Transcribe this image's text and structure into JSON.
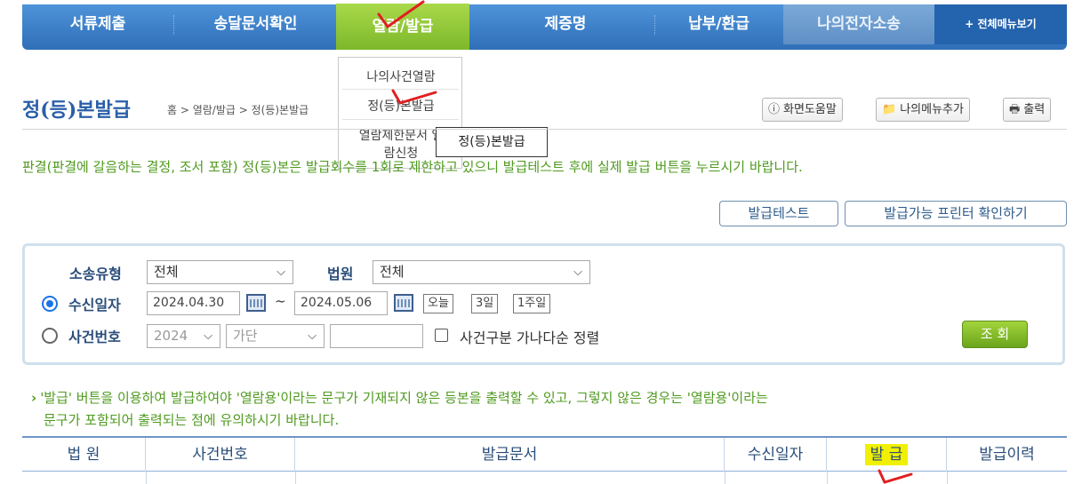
{
  "nav": {
    "items": [
      "서류제출",
      "송달문서확인",
      "열람/발급",
      "제증명",
      "납부/환급",
      "나의전자소송"
    ],
    "all_menu": "+ 전체메뉴보기"
  },
  "dropdown": {
    "items": [
      "나의사건열람",
      "정(등)본발급",
      "열람제한문서 열",
      "람신청"
    ],
    "tooltip": "정(등)본발급"
  },
  "page": {
    "title": "정(등)본발급",
    "breadcrumb": "홈 > 열람/발급 > 정(등)본발급"
  },
  "toolbar": {
    "help": "화면도움말",
    "add_menu": "나의메뉴추가",
    "print": "출력"
  },
  "notice": "판결(판결에 갈음하는 결정, 조서 포함) 정(등)본은 발급회수를 1회로 제한하고 있으니 발급테스트 후에 실제 발급 버튼을 누르시기 바랍니다.",
  "actions": {
    "test": "발급테스트",
    "printer": "발급가능 프린터 확인하기"
  },
  "search": {
    "type_label": "소송유형",
    "type_value": "전체",
    "court_label": "법원",
    "court_value": "전체",
    "date_label": "수신일자",
    "date_from": "2024.04.30",
    "tilde": "~",
    "date_to": "2024.05.06",
    "today": "오늘",
    "three_days": "3일",
    "week": "1주일",
    "case_label": "사건번호",
    "year_value": "2024",
    "case_kind_value": "가단",
    "case_no_value": "",
    "sort_label": "사건구분 가나다순 정렬",
    "search_button": "조 회"
  },
  "info": {
    "line1": "'발급' 버튼을 이용하여 발급하여야 '열람용'이라는 문구가 기재되지 않은 등본을 출력할 수 있고, 그렇지 않은 경우는 '열람용'이라는",
    "line2": "문구가 포함되어 출력되는 점에 유의하시기 바랍니다."
  },
  "table": {
    "headers": [
      "법 원",
      "사건번호",
      "발급문서",
      "수신일자",
      "발 급",
      "발급이력"
    ]
  },
  "colors": {
    "nav_blue": "#2f6fb8",
    "nav_active_green": "#7cb82a",
    "notice_green": "#4f9a1f",
    "title_blue": "#2a5fa8",
    "highlight_yellow": "#f0f000",
    "annotation_red": "#e02020"
  }
}
